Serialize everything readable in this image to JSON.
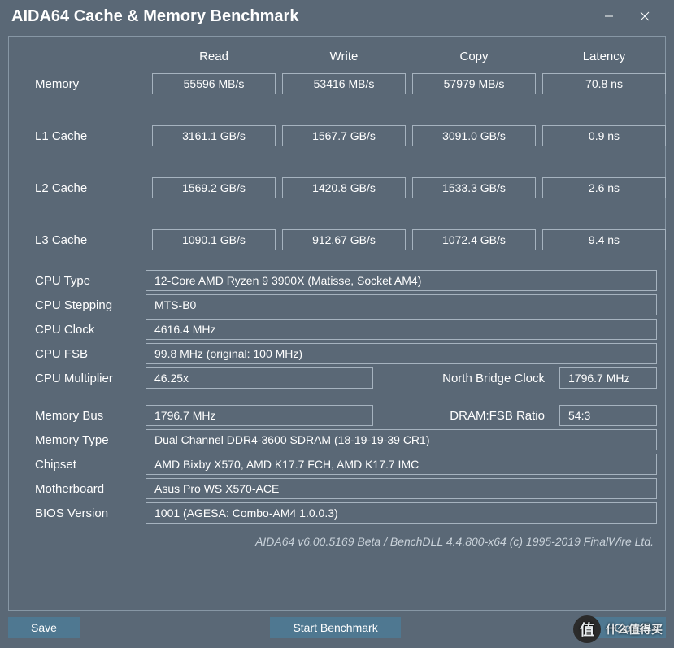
{
  "title": "AIDA64 Cache & Memory Benchmark",
  "columns": {
    "read": "Read",
    "write": "Write",
    "copy": "Copy",
    "latency": "Latency"
  },
  "rows": {
    "memory": {
      "label": "Memory",
      "read": "55596 MB/s",
      "write": "53416 MB/s",
      "copy": "57979 MB/s",
      "latency": "70.8 ns"
    },
    "l1": {
      "label": "L1 Cache",
      "read": "3161.1 GB/s",
      "write": "1567.7 GB/s",
      "copy": "3091.0 GB/s",
      "latency": "0.9 ns"
    },
    "l2": {
      "label": "L2 Cache",
      "read": "1569.2 GB/s",
      "write": "1420.8 GB/s",
      "copy": "1533.3 GB/s",
      "latency": "2.6 ns"
    },
    "l3": {
      "label": "L3 Cache",
      "read": "1090.1 GB/s",
      "write": "912.67 GB/s",
      "copy": "1072.4 GB/s",
      "latency": "9.4 ns"
    }
  },
  "info": {
    "cpu_type": {
      "label": "CPU Type",
      "value": "12-Core AMD Ryzen 9 3900X  (Matisse, Socket AM4)"
    },
    "cpu_stepping": {
      "label": "CPU Stepping",
      "value": "MTS-B0"
    },
    "cpu_clock": {
      "label": "CPU Clock",
      "value": "4616.4 MHz"
    },
    "cpu_fsb": {
      "label": "CPU FSB",
      "value": "99.8 MHz  (original: 100 MHz)"
    },
    "cpu_multiplier": {
      "label": "CPU Multiplier",
      "value": "46.25x",
      "nb_label": "North Bridge Clock",
      "nb_value": "1796.7 MHz"
    },
    "memory_bus": {
      "label": "Memory Bus",
      "value": "1796.7 MHz",
      "ratio_label": "DRAM:FSB Ratio",
      "ratio_value": "54:3"
    },
    "memory_type": {
      "label": "Memory Type",
      "value": "Dual Channel DDR4-3600 SDRAM  (18-19-19-39 CR1)"
    },
    "chipset": {
      "label": "Chipset",
      "value": "AMD Bixby X570, AMD K17.7 FCH, AMD K17.7 IMC"
    },
    "motherboard": {
      "label": "Motherboard",
      "value": "Asus Pro WS X570-ACE"
    },
    "bios": {
      "label": "BIOS Version",
      "value": "1001  (AGESA: Combo-AM4 1.0.0.3)"
    }
  },
  "footer": "AIDA64 v6.00.5169 Beta / BenchDLL 4.4.800-x64  (c) 1995-2019 FinalWire Ltd.",
  "buttons": {
    "save": "Save",
    "start": "Start Benchmark",
    "close": "Close"
  },
  "watermark": {
    "icon": "值",
    "text": "什么值得买"
  }
}
